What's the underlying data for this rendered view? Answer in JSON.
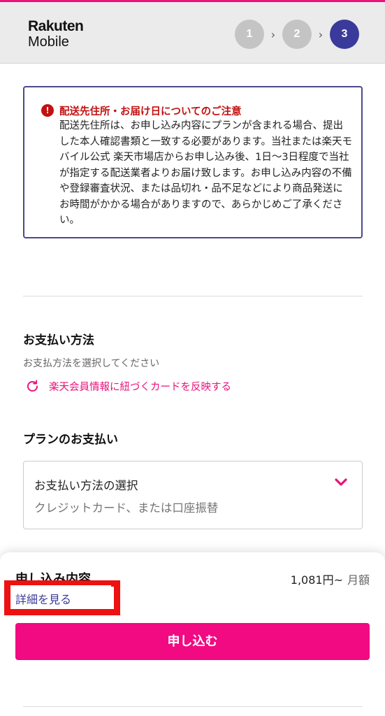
{
  "header": {
    "logo_line1": "Rakuten",
    "logo_line2": "Mobile",
    "steps": [
      "1",
      "2",
      "3"
    ],
    "step_separator": "›",
    "active_step": 3
  },
  "notice": {
    "icon": "!",
    "title": "配送先住所・お届け日についてのご注意",
    "body": "配送先住所は、お申し込み内容にプランが含まれる場合、提出した本人確認書類と一致する必要があります。当社または楽天モバイル公式 楽天市場店からお申し込み後、1日〜3日程度で当社が指定する配送業者よりお届け致します。お申し込み内容の不備や登録審査状況、または品切れ・品不足などにより商品発送に お時間がかかる場合がありますので、あらかじめご了承ください。"
  },
  "payment": {
    "title": "お支払い方法",
    "subtitle": "お支払方法を選択してください",
    "reflect_link": "楽天会員情報に紐づくカードを反映する"
  },
  "plan_payment": {
    "title": "プランのお支払い",
    "select_label": "お支払い方法の選択",
    "select_value": "クレジットカード、または口座振替"
  },
  "summary": {
    "title": "申し込み内容",
    "price": "1,081円~",
    "price_unit": "月額",
    "detail_link": "詳細を見る",
    "apply_button": "申し込む"
  },
  "colors": {
    "accent_pink": "#f10a82",
    "notice_red": "#c31111",
    "navy": "#3a3a9a",
    "highlight_red": "#ee1111"
  }
}
